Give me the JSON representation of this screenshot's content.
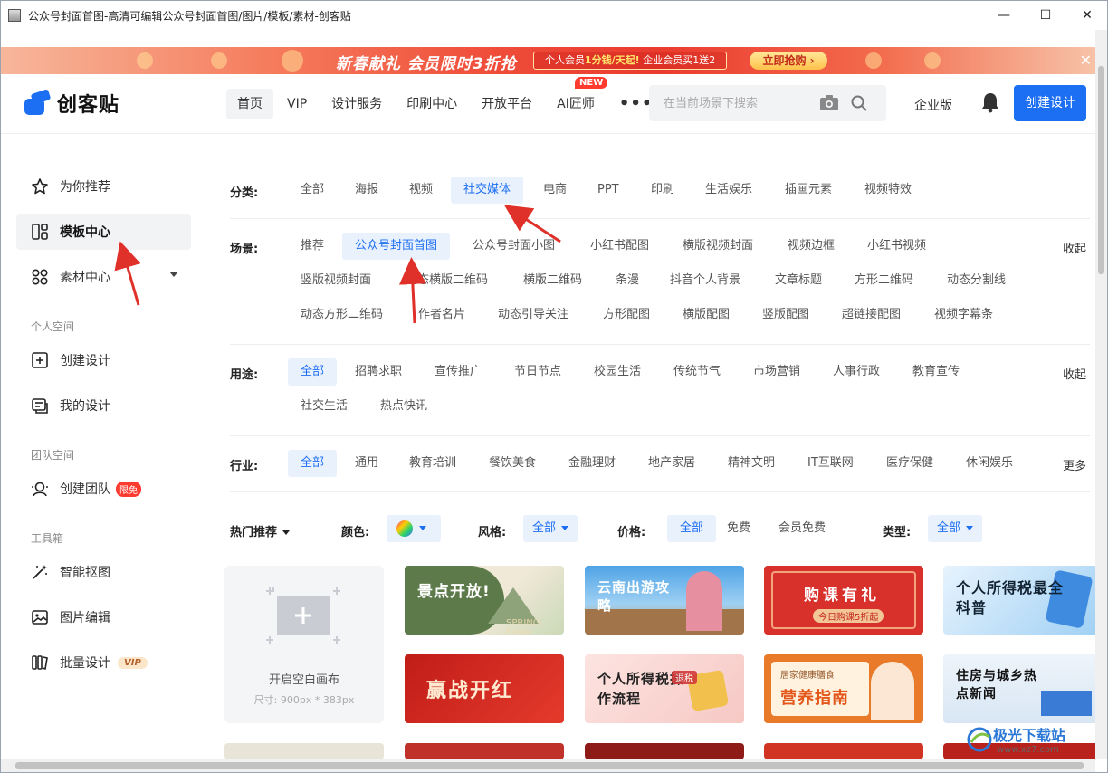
{
  "window": {
    "title": "公众号封面首图-高清可编辑公众号封面首图/图片/模板/素材-创客贴",
    "minimize": "—",
    "maximize": "☐",
    "close": "✕"
  },
  "banner": {
    "headline": "新春献礼 会员限时3折抢",
    "offer_prefix": "个人会员",
    "offer_highlight": "1分钱/天起!",
    "offer_suffix": "企业会员买1送2",
    "cta": "立即抢购 ›",
    "close": "✕"
  },
  "header": {
    "logo_text": "创客贴",
    "nav": [
      "首页",
      "VIP",
      "设计服务",
      "印刷中心",
      "开放平台",
      "AI匠师"
    ],
    "new_badge": "NEW",
    "more": "•••",
    "search_placeholder": "在当前场景下搜索",
    "enterprise": "企业版",
    "create_button": "创建设计"
  },
  "sidebar": {
    "items": [
      {
        "label": "为你推荐",
        "icon": "star-icon"
      },
      {
        "label": "模板中心",
        "icon": "template-icon"
      },
      {
        "label": "素材中心",
        "icon": "material-icon"
      }
    ],
    "group_personal": "个人空间",
    "personal": [
      {
        "label": "创建设计",
        "icon": "add-design-icon"
      },
      {
        "label": "我的设计",
        "icon": "my-design-icon"
      }
    ],
    "group_team": "团队空间",
    "team": [
      {
        "label": "创建团队",
        "icon": "team-icon",
        "tag": "限免"
      }
    ],
    "group_tools": "工具箱",
    "tools": [
      {
        "label": "智能抠图",
        "icon": "magic-wand-icon"
      },
      {
        "label": "图片编辑",
        "icon": "image-edit-icon"
      },
      {
        "label": "批量设计",
        "icon": "batch-icon",
        "tag": "VIP"
      }
    ]
  },
  "filters": {
    "category": {
      "label": "分类:",
      "items": [
        "全部",
        "海报",
        "视频",
        "社交媒体",
        "电商",
        "PPT",
        "印刷",
        "生活娱乐",
        "插画元素",
        "视频特效"
      ],
      "selected": "社交媒体"
    },
    "scene": {
      "label": "场景:",
      "row1": [
        "推荐",
        "公众号封面首图",
        "公众号封面小图",
        "小红书配图",
        "横版视频封面",
        "视频边框",
        "小红书视频"
      ],
      "row2": [
        "竖版视频封面",
        "动态横版二维码",
        "横版二维码",
        "条漫",
        "抖音个人背景",
        "文章标题",
        "方形二维码",
        "动态分割线"
      ],
      "row3": [
        "动态方形二维码",
        "作者名片",
        "动态引导关注",
        "方形配图",
        "横版配图",
        "竖版配图",
        "超链接配图",
        "视频字幕条"
      ],
      "selected": "公众号封面首图",
      "toggle": "收起"
    },
    "usage": {
      "label": "用途:",
      "row1": [
        "全部",
        "招聘求职",
        "宣传推广",
        "节日节点",
        "校园生活",
        "传统节气",
        "市场营销",
        "人事行政",
        "教育宣传"
      ],
      "row2": [
        "社交生活",
        "热点快讯"
      ],
      "selected": "全部",
      "toggle": "收起"
    },
    "industry": {
      "label": "行业:",
      "items": [
        "全部",
        "通用",
        "教育培训",
        "餐饮美食",
        "金融理财",
        "地产家居",
        "精神文明",
        "IT互联网",
        "医疗保健",
        "休闲娱乐"
      ],
      "selected": "全部",
      "more": "更多"
    }
  },
  "options": {
    "sort": "热门推荐",
    "color_label": "颜色:",
    "style_label": "风格:",
    "style_value": "全部",
    "price_label": "价格:",
    "price_items": [
      "全部",
      "免费",
      "会员免费"
    ],
    "type_label": "类型:",
    "type_value": "全部"
  },
  "blank_canvas": {
    "title": "开启空白画布",
    "size": "尺寸: 900px * 383px"
  },
  "cards": [
    {
      "title": "景点开放!",
      "sub": "SPRING TOUR",
      "color": "#5d7a4a"
    },
    {
      "title": "云南出游攻略",
      "sub": "",
      "color": "#2f86c9"
    },
    {
      "title": "购课有礼",
      "sub": "今日购课5折起",
      "color": "#d8312c"
    },
    {
      "title": "个人所得税最全科普",
      "sub": "",
      "color": "#5aa6e8"
    },
    {
      "title": "赢战开红",
      "sub": "",
      "color": "#b8201a"
    },
    {
      "title": "个人所得税操作流程",
      "sub": "退税",
      "color": "#f6c8c4"
    },
    {
      "title": "营养指南",
      "sub": "居家健康膳食",
      "color": "#e87a2a"
    },
    {
      "title": "住房与城乡热点新闻",
      "sub": "",
      "color": "#d8e6f4"
    }
  ],
  "watermark": {
    "title": "极光下载站",
    "site": "www.xz7.com"
  }
}
